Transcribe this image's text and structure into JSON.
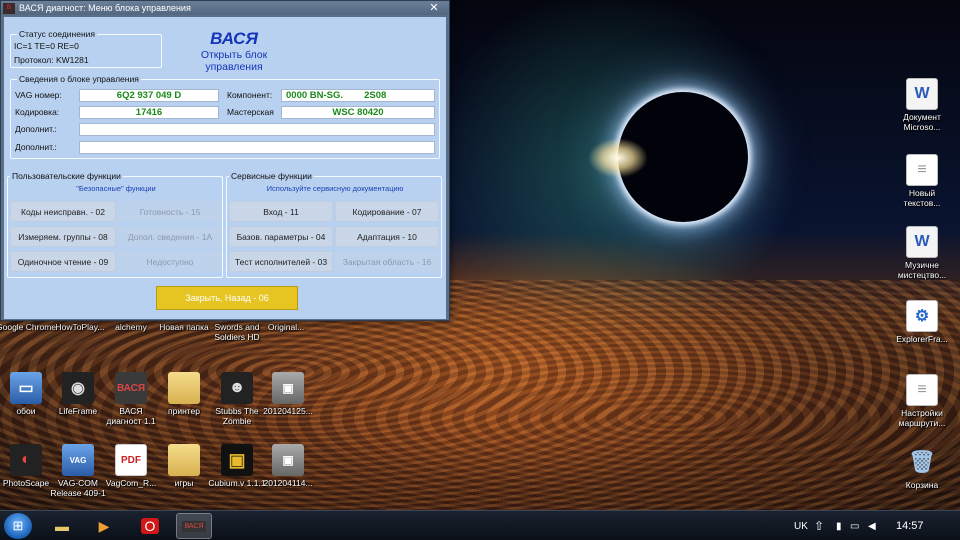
{
  "window": {
    "title": "ВАСЯ диагност: Меню блока управления",
    "close_glyph": "✕"
  },
  "connection_status": {
    "title": "Статус соединения",
    "line1": "IC=1  TE=0   RE=0",
    "line2": "Протокол: KW1281"
  },
  "header": {
    "brand": "ВАСЯ",
    "subtitle": "Открыть блок управления"
  },
  "ecu_info": {
    "title": "Сведения о блоке управления",
    "vag_label": "VAG номер:",
    "vag_value": "6Q2 937 049 D",
    "component_label": "Компонент:",
    "component_value": "0000 BN-SG.        2S08",
    "coding_label": "Кодировка:",
    "coding_value": "17416",
    "workshop_label": "Мастерская",
    "workshop_value": "WSC 80420",
    "extra1_label": "Дополнит.:",
    "extra1_value": "",
    "extra2_label": "Дополнит.:",
    "extra2_value": ""
  },
  "user_functions": {
    "title": "Пользовательские функции",
    "hint": "\"Безопасные\" функции",
    "buttons": [
      {
        "label": "Коды неисправн. - 02",
        "enabled": true
      },
      {
        "label": "Готовность - 15",
        "enabled": false
      },
      {
        "label": "Измеряем. группы - 08",
        "enabled": true
      },
      {
        "label": "Допол. сведения - 1А",
        "enabled": false
      },
      {
        "label": "Одиночное чтение - 09",
        "enabled": true
      },
      {
        "label": "Недоступно",
        "enabled": false
      }
    ]
  },
  "service_functions": {
    "title": "Сервисные функции",
    "hint": "Используйте сервисную документацию",
    "buttons": [
      {
        "label": "Вход - 11",
        "enabled": true
      },
      {
        "label": "Кодирование - 07",
        "enabled": true
      },
      {
        "label": "Базов. параметры - 04",
        "enabled": true
      },
      {
        "label": "Адаптация - 10",
        "enabled": true
      },
      {
        "label": "Тест исполнителей - 03",
        "enabled": true
      },
      {
        "label": "Закрытая область - 16",
        "enabled": false
      }
    ]
  },
  "close_button": "Закрыть, Назад - 06",
  "desktop_icons_right": [
    {
      "label": "Документ Microso...",
      "icon": "word-doc-icon"
    },
    {
      "label": "Новый текстов...",
      "icon": "text-file-icon"
    },
    {
      "label": "Музичне мистецтво...",
      "icon": "word-doc-icon"
    },
    {
      "label": "ExplorerFra...",
      "icon": "explorer-icon"
    },
    {
      "label": "Настройки маршрути...",
      "icon": "text-file-icon"
    },
    {
      "label": "Корзина",
      "icon": "recycle-bin-icon"
    }
  ],
  "desktop_icons_row1": [
    {
      "label": "Google Chrome"
    },
    {
      "label": "HowToPlay..."
    },
    {
      "label": "alchemy"
    },
    {
      "label": "Новая папка"
    },
    {
      "label": "Swords and Soldiers HD"
    },
    {
      "label": "Original..."
    }
  ],
  "desktop_icons_row2": [
    {
      "label": "обои"
    },
    {
      "label": "LifeFrame"
    },
    {
      "label": "ВАСЯ диагност 1.1"
    },
    {
      "label": "принтер"
    },
    {
      "label": "Stubbs The Zombie"
    },
    {
      "label": "201204125..."
    }
  ],
  "desktop_icons_row3": [
    {
      "label": "PhotoScape"
    },
    {
      "label": "VAG-COM Release 409-1"
    },
    {
      "label": "VagCom_R..."
    },
    {
      "label": "игры"
    },
    {
      "label": "Cubium.v 1.1.1"
    },
    {
      "label": "201204114..."
    }
  ],
  "taskbar": {
    "language": "UK",
    "time": "14:57"
  },
  "colors": {
    "client_bg": "#b9d1f0",
    "brand_blue": "#1435b8",
    "value_green": "#1a8a1a",
    "close_yellow": "#e6c523"
  }
}
